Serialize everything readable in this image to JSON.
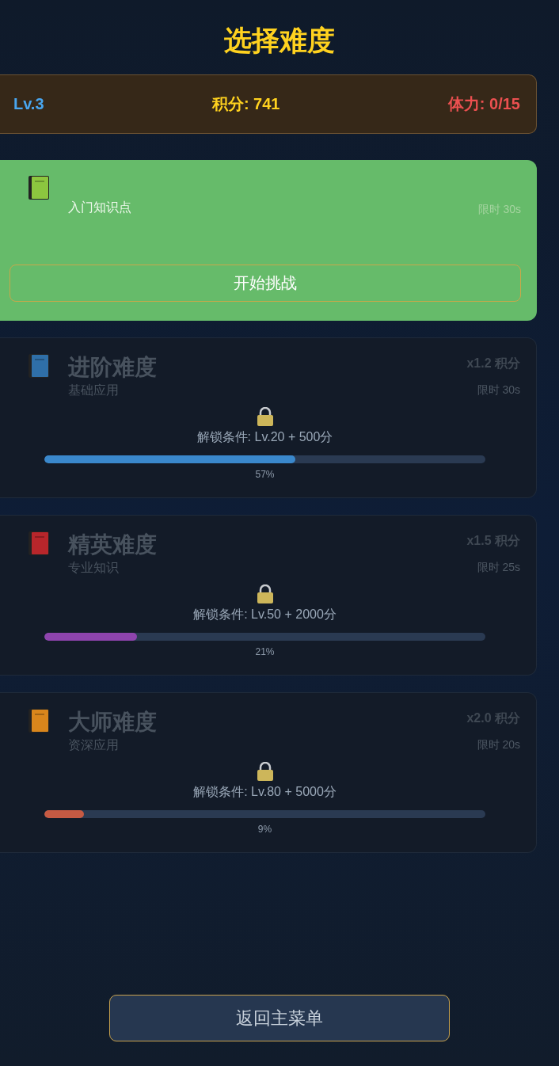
{
  "title": "选择难度",
  "stats": {
    "level": "Lv.3",
    "score": "积分: 741",
    "stamina": "体力: 0/15"
  },
  "difficulties": [
    {
      "kind": "unlocked",
      "color": "#8cc63f",
      "subtitle": "入门知识点",
      "time": "限时 30s",
      "button": "开始挑战"
    },
    {
      "kind": "locked",
      "color": "#2f6fa8",
      "title": "进阶难度",
      "subtitle": "基础应用",
      "multiplier": "x1.2 积分",
      "time": "限时 30s",
      "condition": "解锁条件: Lv.20 + 500分",
      "progress": {
        "level": 0.57,
        "color": "#3a88cc"
      },
      "percent": "57%"
    },
    {
      "kind": "locked",
      "color": "#b8262b",
      "title": "精英难度",
      "subtitle": "专业知识",
      "multiplier": "x1.5 积分",
      "time": "限时 25s",
      "condition": "解锁条件: Lv.50 + 2000分",
      "progress": {
        "level": 0.21,
        "color": "#8e44ad"
      },
      "percent": "21%"
    },
    {
      "kind": "locked",
      "color": "#d9861c",
      "title": "大师难度",
      "subtitle": "资深应用",
      "multiplier": "x2.0 积分",
      "time": "限时 20s",
      "condition": "解锁条件: Lv.80 + 5000分",
      "progress": {
        "level": 0.09,
        "color": "#c65a43"
      },
      "percent": "9%"
    }
  ],
  "back_button": "返回主菜单"
}
